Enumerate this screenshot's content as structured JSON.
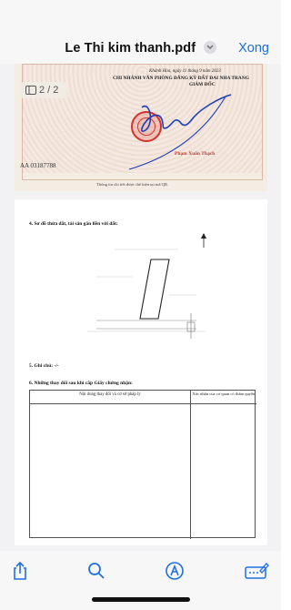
{
  "header": {
    "title": "Le Thi kim thanh.pdf",
    "done_label": "Xong"
  },
  "page_indicator": "2 / 2",
  "page1": {
    "line1": "Khánh Hòa, ngày 11 tháng 9 năm 2023",
    "line2": "CHI NHÁNH VĂN PHÒNG ĐĂNG KÝ ĐẤT ĐAI NHA TRANG",
    "line3": "GIÁM ĐỐC",
    "signer": "Phạm Xuân Thạch",
    "cert_code": "AA 03187788",
    "qr_note": "Thông tin chi tiết được thể hiện tại mã QR."
  },
  "page2": {
    "section4": "4. Sơ đồ thửa đất, tài sản gắn liền với đất:",
    "section5": "5. Ghi chú: -/-",
    "section6": "6. Những thay đổi sau khi cấp Giấy chứng nhận:",
    "table_col1": "Nội dung thay đổi và cơ sở pháp lý",
    "table_col2": "Xác nhận của cơ quan có thẩm quyền"
  },
  "toolbar": {
    "share": "share-icon",
    "search": "search-icon",
    "markup": "markup-icon",
    "annotate": "annotate-icon"
  },
  "colors": {
    "accent": "#1f6fe0",
    "stamp": "#d2322d",
    "signature": "#1c3fb8"
  }
}
